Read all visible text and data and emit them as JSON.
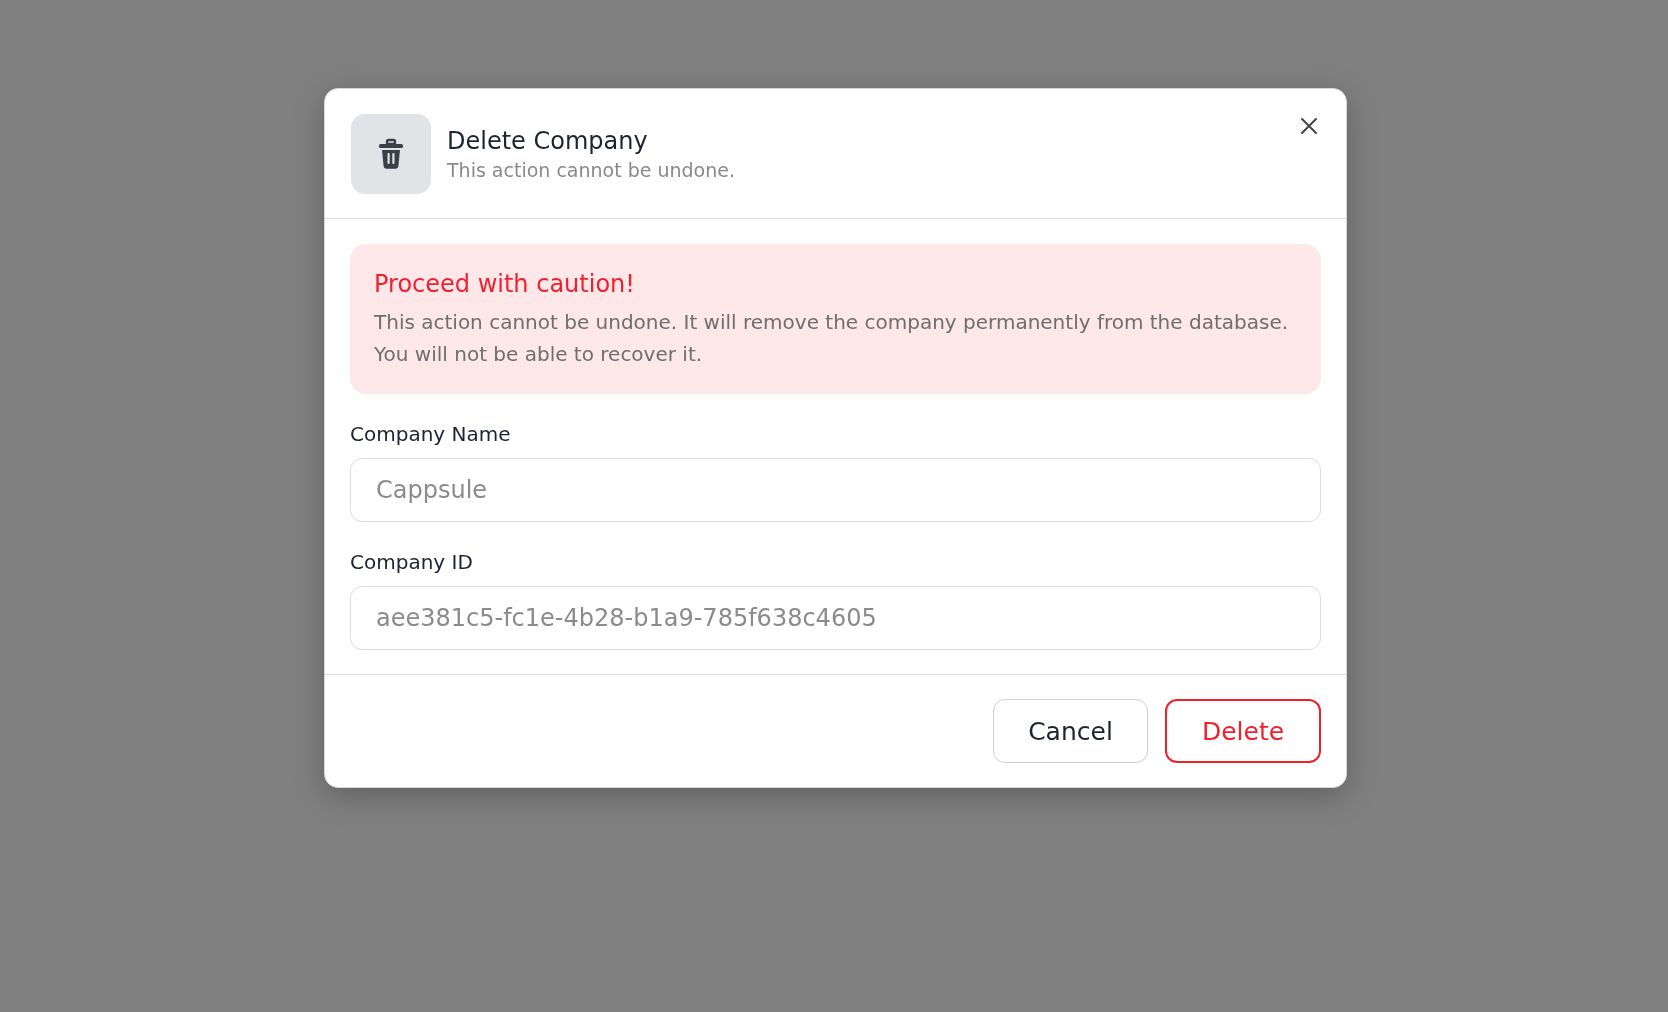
{
  "dialog": {
    "title": "Delete Company",
    "subtitle": "This action cannot be undone.",
    "alert": {
      "title": "Proceed with caution!",
      "message": "This action cannot be undone. It will remove the company permanently from the database. You will not be able to recover it."
    },
    "fields": [
      {
        "label": "Company Name",
        "value": "Cappsule",
        "disabled": true
      },
      {
        "label": "Company ID",
        "value": "aee381c5-fc1e-4b28-b1a9-785f638c4605",
        "disabled": true
      }
    ],
    "buttons": [
      {
        "label": "Cancel",
        "kind": "secondary"
      },
      {
        "label": "Delete",
        "kind": "danger"
      }
    ]
  }
}
